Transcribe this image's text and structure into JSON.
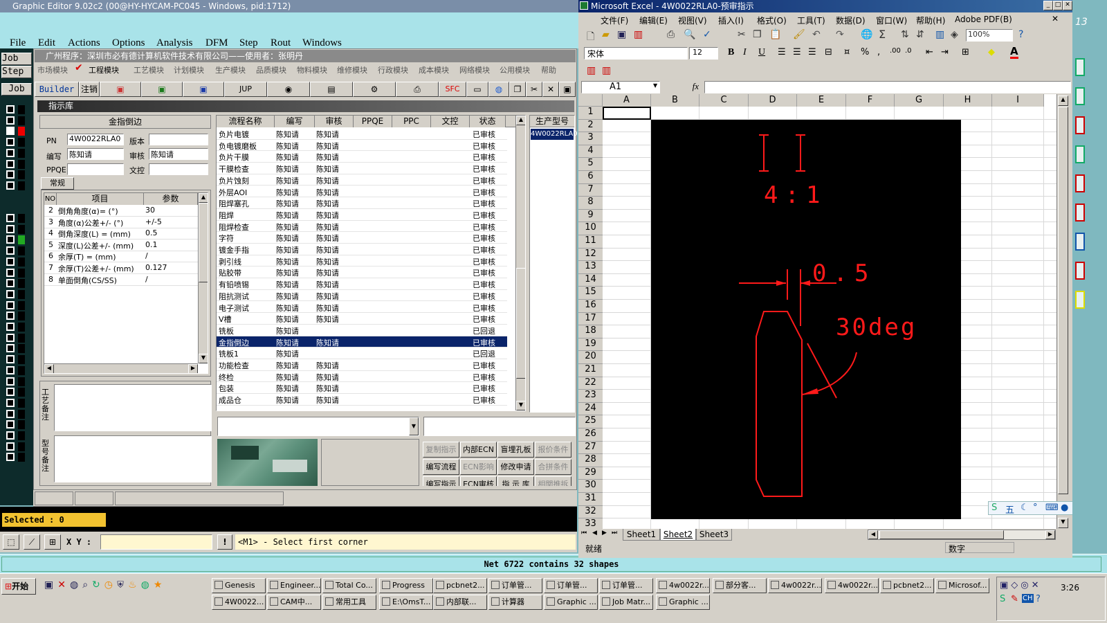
{
  "ge": {
    "title": "Graphic Editor 9.02c2 (00@HY-HYCAM-PC045 - Windows, pid:1712)",
    "menu": [
      "File",
      "Edit",
      "Actions",
      "Options",
      "Analysis",
      "DFM",
      "Step",
      "Rout",
      "Windows"
    ],
    "left_tabs": [
      "Job",
      "Step",
      "Job"
    ],
    "selected": "Selected : 0",
    "xy_label": "X Y :",
    "status_msg": "<M1> - Select first corner",
    "net_msg": "Net 6722 contains 32 shapes"
  },
  "inner": {
    "title": "广州程序：深圳市必有德计算机软件技术有限公司——使用者：张明丹",
    "modules": [
      "市场模块",
      "工程模块",
      "工艺模块",
      "计划模块",
      "生产模块",
      "品质模块",
      "物料模块",
      "维修模块",
      "行政模块",
      "成本模块",
      "网络模块",
      "公用模块",
      "帮助"
    ],
    "toolbar": [
      "Builder",
      "注销",
      "JUP",
      "SFC"
    ],
    "panel_title": "指示库",
    "form": {
      "heading": "金指倒边",
      "pn_label": "PN",
      "pn_value": "4W0022RLA0",
      "ver_label": "版本",
      "ver_value": "",
      "author_label": "编写",
      "author_value": "陈知请",
      "review_label": "审核",
      "review_value": "陈知请",
      "ppqe_label": "PPQE",
      "ppqe_value": "",
      "wk_label": "文控",
      "wk_value": "",
      "tab": "常规"
    },
    "params_headers": [
      "NO",
      "项目",
      "参数"
    ],
    "params": [
      {
        "no": "2",
        "item": "倒角角度(α)=  (°)",
        "val": "30"
      },
      {
        "no": "3",
        "item": "角度(α)公差+/-  (°)",
        "val": "+/-5"
      },
      {
        "no": "4",
        "item": "倒角深度(L) =  (mm)",
        "val": "0.5"
      },
      {
        "no": "5",
        "item": "深度(L)公差+/-  (mm)",
        "val": "0.1"
      },
      {
        "no": "6",
        "item": "余厚(T) =  (mm)",
        "val": "/"
      },
      {
        "no": "7",
        "item": "余厚(T)公差+/-  (mm)",
        "val": "0.127"
      },
      {
        "no": "8",
        "item": "单面倒角(CS/SS)",
        "val": "/"
      }
    ],
    "remark1": "工艺备注",
    "remark2": "型号备注",
    "flow_headers": [
      "流程名称",
      "编写",
      "审核",
      "PPQE",
      "PPC",
      "文控",
      "状态"
    ],
    "flows": [
      {
        "name": "负片电镀",
        "a": "陈知请",
        "b": "陈知请",
        "s": "已审核"
      },
      {
        "name": "负电镀磨板",
        "a": "陈知请",
        "b": "陈知请",
        "s": "已审核"
      },
      {
        "name": "负片干膜",
        "a": "陈知请",
        "b": "陈知请",
        "s": "已审核"
      },
      {
        "name": "干膜检查",
        "a": "陈知请",
        "b": "陈知请",
        "s": "已审核"
      },
      {
        "name": "负片蚀刻",
        "a": "陈知请",
        "b": "陈知请",
        "s": "已审核"
      },
      {
        "name": "外层AOI",
        "a": "陈知请",
        "b": "陈知请",
        "s": "已审核"
      },
      {
        "name": "阻焊塞孔",
        "a": "陈知请",
        "b": "陈知请",
        "s": "已审核"
      },
      {
        "name": "阻焊",
        "a": "陈知请",
        "b": "陈知请",
        "s": "已审核"
      },
      {
        "name": "阻焊检查",
        "a": "陈知请",
        "b": "陈知请",
        "s": "已审核"
      },
      {
        "name": "字符",
        "a": "陈知请",
        "b": "陈知请",
        "s": "已审核"
      },
      {
        "name": "镀金手指",
        "a": "陈知请",
        "b": "陈知请",
        "s": "已审核"
      },
      {
        "name": "剥引线",
        "a": "陈知请",
        "b": "陈知请",
        "s": "已审核"
      },
      {
        "name": "贴胶带",
        "a": "陈知请",
        "b": "陈知请",
        "s": "已审核"
      },
      {
        "name": "有铅喷锡",
        "a": "陈知请",
        "b": "陈知请",
        "s": "已审核"
      },
      {
        "name": "阻抗测试",
        "a": "陈知请",
        "b": "陈知请",
        "s": "已审核"
      },
      {
        "name": "电子测试",
        "a": "陈知请",
        "b": "陈知请",
        "s": "已审核"
      },
      {
        "name": "V槽",
        "a": "陈知请",
        "b": "陈知请",
        "s": "已审核"
      },
      {
        "name": "铣板",
        "a": "陈知请",
        "b": "",
        "s": "已回退"
      },
      {
        "name": "金指倒边",
        "a": "陈知请",
        "b": "陈知请",
        "s": "已审核"
      },
      {
        "name": "铣板1",
        "a": "陈知请",
        "b": "",
        "s": "已回退"
      },
      {
        "name": "功能检查",
        "a": "陈知请",
        "b": "陈知请",
        "s": "已审核"
      },
      {
        "name": "终检",
        "a": "陈知请",
        "b": "陈知请",
        "s": "已审核"
      },
      {
        "name": "包装",
        "a": "陈知请",
        "b": "陈知请",
        "s": "已审核"
      },
      {
        "name": "成品仓",
        "a": "陈知请",
        "b": "陈知请",
        "s": "已审核"
      }
    ],
    "model_header": "生产型号",
    "model_value": "4W0022RLA0",
    "actions": [
      "复制指示",
      "内部ECN",
      "盲埋孔板",
      "报价条件",
      "编写流程",
      "ECN影响",
      "修改申请",
      "合拼条件",
      "编写指示",
      "ECN审核",
      "指 示 库",
      "相関推拆"
    ]
  },
  "xl": {
    "title": "Microsoft Excel - 4W0022RLA0-预审指示",
    "menu": [
      "文件(F)",
      "编辑(E)",
      "视图(V)",
      "插入(I)",
      "格式(O)",
      "工具(T)",
      "数据(D)",
      "窗口(W)",
      "帮助(H)",
      "Adobe PDF(B)"
    ],
    "zoom": "100%",
    "font": "宋体",
    "size": "12",
    "namebox": "A1",
    "fx": "fx",
    "cols": [
      "A",
      "B",
      "C",
      "D",
      "E",
      "F",
      "G",
      "H",
      "I"
    ],
    "rows": [
      "1",
      "2",
      "3",
      "4",
      "5",
      "6",
      "7",
      "8",
      "9",
      "10",
      "11",
      "12",
      "13",
      "14",
      "15",
      "16",
      "17",
      "18",
      "19",
      "20",
      "21",
      "22",
      "23",
      "24",
      "25",
      "26",
      "27",
      "28",
      "29",
      "30",
      "31",
      "32",
      "33"
    ],
    "sheets": [
      "Sheet1",
      "Sheet2",
      "Sheet3"
    ],
    "status_left": "就绪",
    "status_right": "数字",
    "drawing": {
      "ratio": "4:1",
      "depth": "0.5",
      "angle": "30deg"
    }
  },
  "taskbar": {
    "start": "开始",
    "row1": [
      "Genesis",
      "Engineer...",
      "Total Co...",
      "Progress",
      "pcbnet2...",
      "订单管...",
      "订单管...",
      "订单管...",
      "4w0022r...",
      "部分客...",
      "4w0022r...",
      "4w0022r...",
      "pcbnet2...",
      "Microsof..."
    ],
    "row2": [
      "4W0022...",
      "CAM中...",
      "常用工具",
      "E:\\OmsT...",
      "内部联...",
      "计算器",
      "Graphic ...",
      "Job Matr...",
      "Graphic ..."
    ],
    "clock": "3:26",
    "ime": "CH"
  }
}
